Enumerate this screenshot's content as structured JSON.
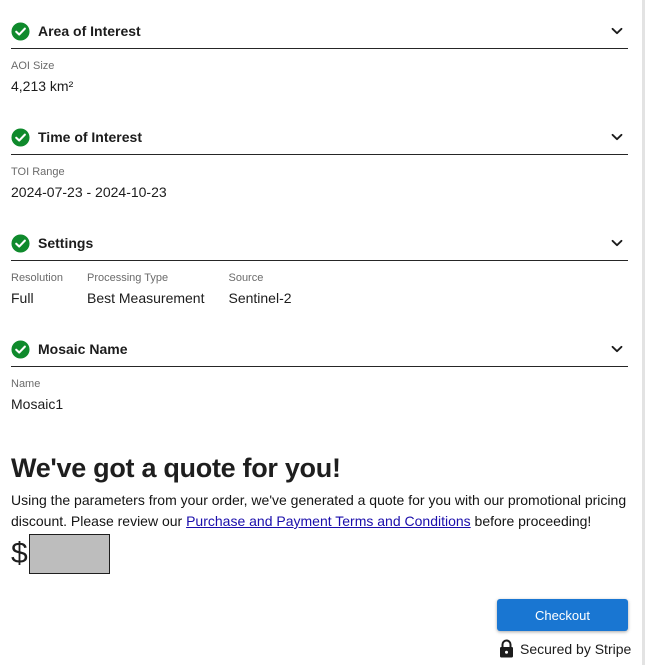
{
  "sections": [
    {
      "title": "Area of Interest",
      "fields": [
        {
          "label": "AOI Size",
          "value": "4,213 km²"
        }
      ]
    },
    {
      "title": "Time of Interest",
      "fields": [
        {
          "label": "TOI Range",
          "value": "2024-07-23 - 2024-10-23"
        }
      ]
    },
    {
      "title": "Settings",
      "fields": [
        {
          "label": "Resolution",
          "value": "Full"
        },
        {
          "label": "Processing Type",
          "value": "Best Measurement"
        },
        {
          "label": "Source",
          "value": "Sentinel-2"
        }
      ]
    },
    {
      "title": "Mosaic Name",
      "fields": [
        {
          "label": "Name",
          "value": "Mosaic1"
        }
      ]
    }
  ],
  "icons": {
    "section_status": "check-circle-icon",
    "section_toggle": "chevron-down-icon",
    "secure": "lock-icon"
  },
  "colors": {
    "check_green": "#0f8a2c",
    "button_blue": "#1976d2",
    "link_blue": "#1a0dab"
  },
  "quote": {
    "title": "We've got a quote for you!",
    "text_before": "Using the parameters from your order, we've generated a quote for you with our promotional pricing discount. Please review our ",
    "link_text": "Purchase and Payment Terms and Conditions",
    "text_after": " before proceeding!",
    "currency": "$"
  },
  "checkout": {
    "button_label": "Checkout",
    "secured_text": "Secured by Stripe"
  }
}
